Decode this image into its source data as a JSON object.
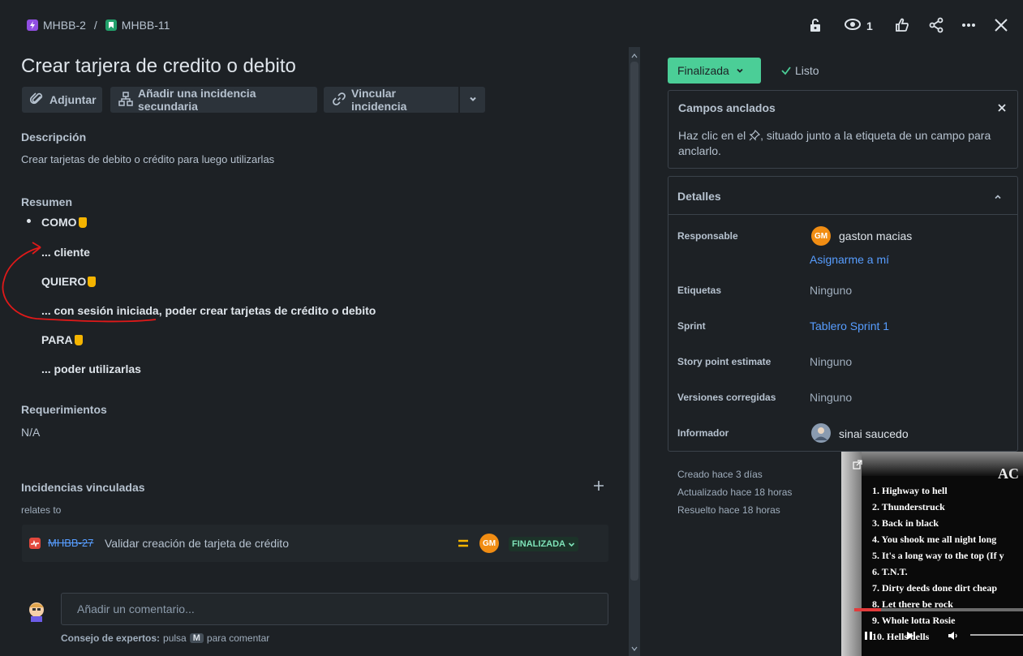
{
  "breadcrumb": {
    "parent_key": "MHBB-2",
    "separator": "/",
    "issue_key": "MHBB-11",
    "parent_icon_color": "#904ee2",
    "issue_icon_color": "#22a06b"
  },
  "header_actions": {
    "watch_count": "1"
  },
  "issue": {
    "title": "Crear tarjera de credito o debito"
  },
  "toolbar": {
    "attach_label": "Adjuntar",
    "add_child_label": "Añadir una incidencia secundaria",
    "link_issue_label": "Vincular incidencia"
  },
  "description": {
    "heading": "Descripción",
    "text": "Crear tarjetas de debito o crédito para luego utilizarlas",
    "summary_heading": "Resumen",
    "lines": [
      "COMO",
      "... cliente",
      "QUIERO",
      "... con sesión iniciada, poder crear tarjetas de crédito o debito",
      "PARA",
      "... poder utilizarlas"
    ],
    "requirements_heading": "Requerimientos",
    "requirements_text": "N/A"
  },
  "linked_issues": {
    "heading": "Incidencias vinculadas",
    "relation": "relates to",
    "items": [
      {
        "key": "MHBB-27",
        "summary": "Validar creación de tarjeta de crédito",
        "avatar_initials": "GM",
        "status": "FINALIZADA"
      }
    ]
  },
  "comment": {
    "placeholder": "Añadir un comentario...",
    "tip_prefix": "Consejo de expertos:",
    "tip_middle": "pulsa",
    "tip_key": "M",
    "tip_suffix": "para comentar"
  },
  "status": {
    "button_label": "Finalizada",
    "resolution_label": "Listo",
    "button_color": "#4bce97"
  },
  "pinned_fields": {
    "title": "Campos anclados",
    "text_before": "Haz clic en el",
    "text_after": ", situado junto a la etiqueta de un campo para anclarlo."
  },
  "details": {
    "title": "Detalles",
    "assignee_label": "Responsable",
    "assignee_name": "gaston macias",
    "assignee_initials": "GM",
    "assign_to_me": "Asignarme a mí",
    "labels_label": "Etiquetas",
    "labels_value": "Ninguno",
    "sprint_label": "Sprint",
    "sprint_value": "Tablero Sprint 1",
    "story_points_label": "Story point estimate",
    "story_points_value": "Ninguno",
    "fix_versions_label": "Versiones corregidas",
    "fix_versions_value": "Ninguno",
    "reporter_label": "Informador",
    "reporter_name": "sinai saucedo"
  },
  "timestamps": {
    "created": "Creado hace 3 días",
    "updated": "Actualizado hace 18 horas",
    "resolved": "Resuelto hace 18 horas"
  },
  "video_overlay": {
    "header_text": "AC",
    "tracks": [
      "1. Highway to hell",
      "2. Thunderstruck",
      "3. Back in black",
      "4. You shook me all night long",
      "5. It's a long way to the top (If y",
      "6. T.N.T.",
      "7. Dirty deeds done dirt cheap",
      "8. Let there be rock",
      "9. Whole lotta Rosie",
      "10. Hells bells"
    ],
    "progress": 0.16
  }
}
